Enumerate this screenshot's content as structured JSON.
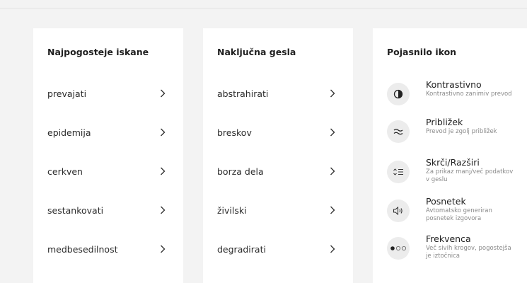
{
  "columns": {
    "popular": {
      "title": "Najpogosteje iskane",
      "items": [
        "prevajati",
        "epidemija",
        "cerkven",
        "sestankovati",
        "medbesedilnost"
      ]
    },
    "random": {
      "title": "Naključna gesla",
      "items": [
        "abstrahirati",
        "breskov",
        "borza dela",
        "živilski",
        "degradirati"
      ]
    },
    "legend": {
      "title": "Pojasnilo ikon",
      "items": [
        {
          "name": "Kontrastivno",
          "desc": "Kontrastivno zanimiv prevod",
          "icon": "contrast-icon"
        },
        {
          "name": "Približek",
          "desc": "Prevod je zgolj približek",
          "icon": "approx-icon"
        },
        {
          "name": "Skrči/Razširi",
          "desc": "Za prikaz manj/več podatkov v geslu",
          "icon": "collapse-expand-icon"
        },
        {
          "name": "Posnetek",
          "desc": "Avtomatsko generiran posnetek izgovora",
          "icon": "speaker-icon"
        },
        {
          "name": "Frekvenca",
          "desc": "Več sivih krogov, pogostejša je iztočnica",
          "icon": "frequency-icon"
        }
      ]
    }
  }
}
